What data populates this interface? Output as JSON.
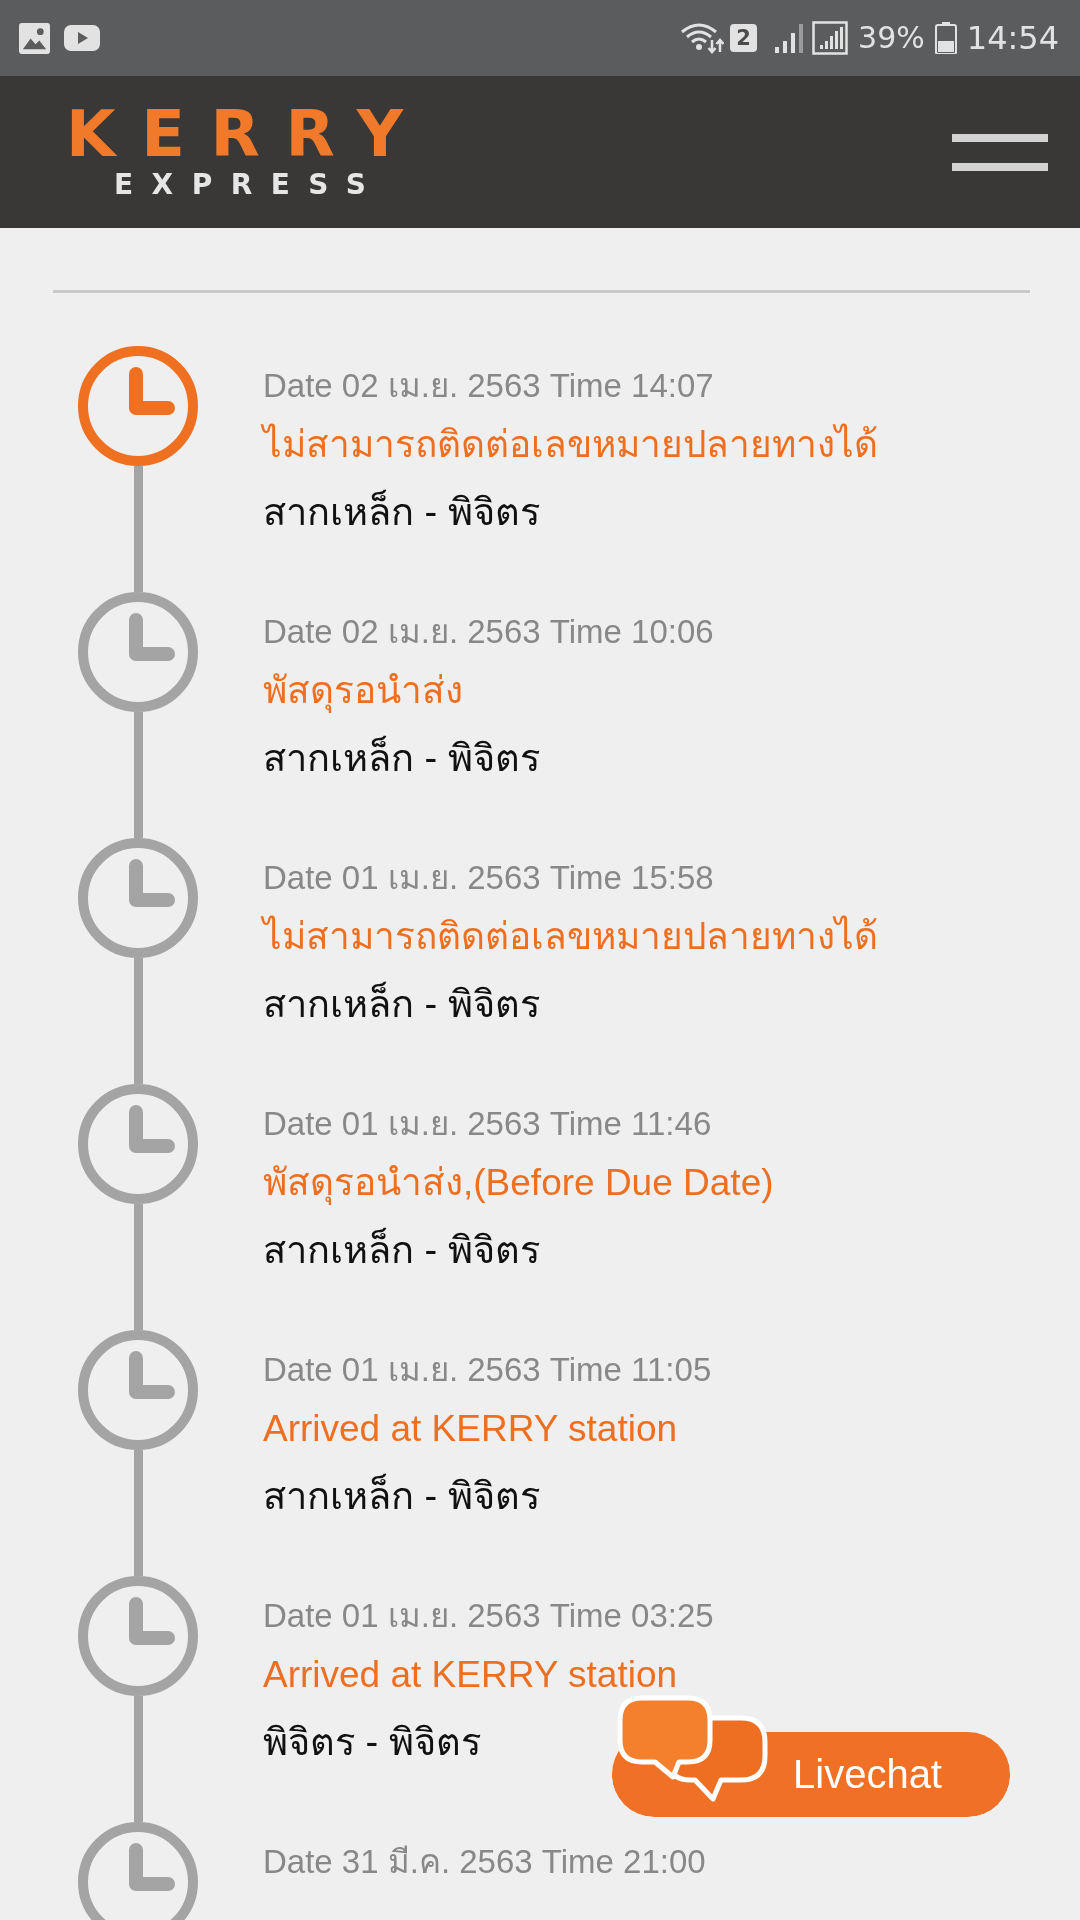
{
  "status_bar": {
    "sim_slot": "2",
    "battery": "39%",
    "time": "14:54"
  },
  "header": {
    "logo": {
      "name": "KERRY",
      "tagline": "EXPRESS"
    }
  },
  "timeline": [
    {
      "datetime": "Date 02 เม.ย. 2563 Time 14:07",
      "status": "ไม่สามารถติดต่อเลขหมายปลายทางได้",
      "location": "สากเหล็ก - พิจิตร",
      "current": true
    },
    {
      "datetime": "Date 02 เม.ย. 2563 Time 10:06",
      "status": "พัสดุรอนำส่ง",
      "location": "สากเหล็ก - พิจิตร",
      "current": false
    },
    {
      "datetime": "Date 01 เม.ย. 2563 Time 15:58",
      "status": "ไม่สามารถติดต่อเลขหมายปลายทางได้",
      "location": "สากเหล็ก - พิจิตร",
      "current": false
    },
    {
      "datetime": "Date 01 เม.ย. 2563 Time 11:46",
      "status": "พัสดุรอนำส่ง,(Before Due Date)",
      "location": "สากเหล็ก - พิจิตร",
      "current": false
    },
    {
      "datetime": "Date 01 เม.ย. 2563 Time 11:05",
      "status": "Arrived at KERRY station",
      "location": "สากเหล็ก - พิจิตร",
      "current": false
    },
    {
      "datetime": "Date 01 เม.ย. 2563 Time 03:25",
      "status": "Arrived at KERRY station",
      "location": "พิจิตร - พิจิตร",
      "current": false
    },
    {
      "datetime": "Date 31 มี.ค. 2563 Time 21:00",
      "current": false
    }
  ],
  "livechat": {
    "label": "Livechat"
  }
}
